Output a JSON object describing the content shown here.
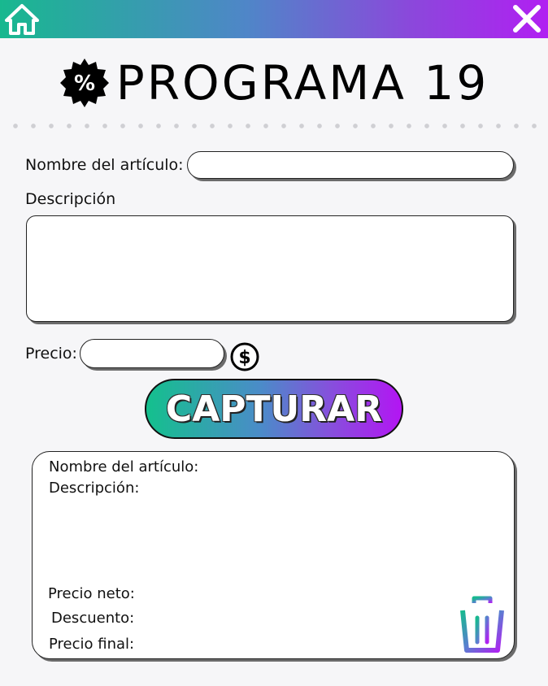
{
  "header": {
    "home_icon": "home-icon",
    "close_icon": "close-icon",
    "gradient_colors": [
      "#18b88f",
      "#4f86c8",
      "#8b48db",
      "#b11ff2"
    ]
  },
  "title": {
    "icon": "discount-badge-icon",
    "icon_text": "%",
    "text": "PROGRAMA 19"
  },
  "form": {
    "name_label": "Nombre del artículo:",
    "name_value": "",
    "description_label": "Descripción",
    "description_value": "",
    "price_label": "Precio:",
    "price_value": "",
    "price_icon": "dollar-circle-icon",
    "dollar_symbol": "$",
    "capture_label": "CAPTURAR"
  },
  "result": {
    "name_label": "Nombre del artículo:",
    "description_label": "Descripción:",
    "net_price_label": "Precio neto:",
    "discount_label": "Descuento:",
    "final_price_label": "Precio final:",
    "delete_icon": "trash-icon"
  }
}
